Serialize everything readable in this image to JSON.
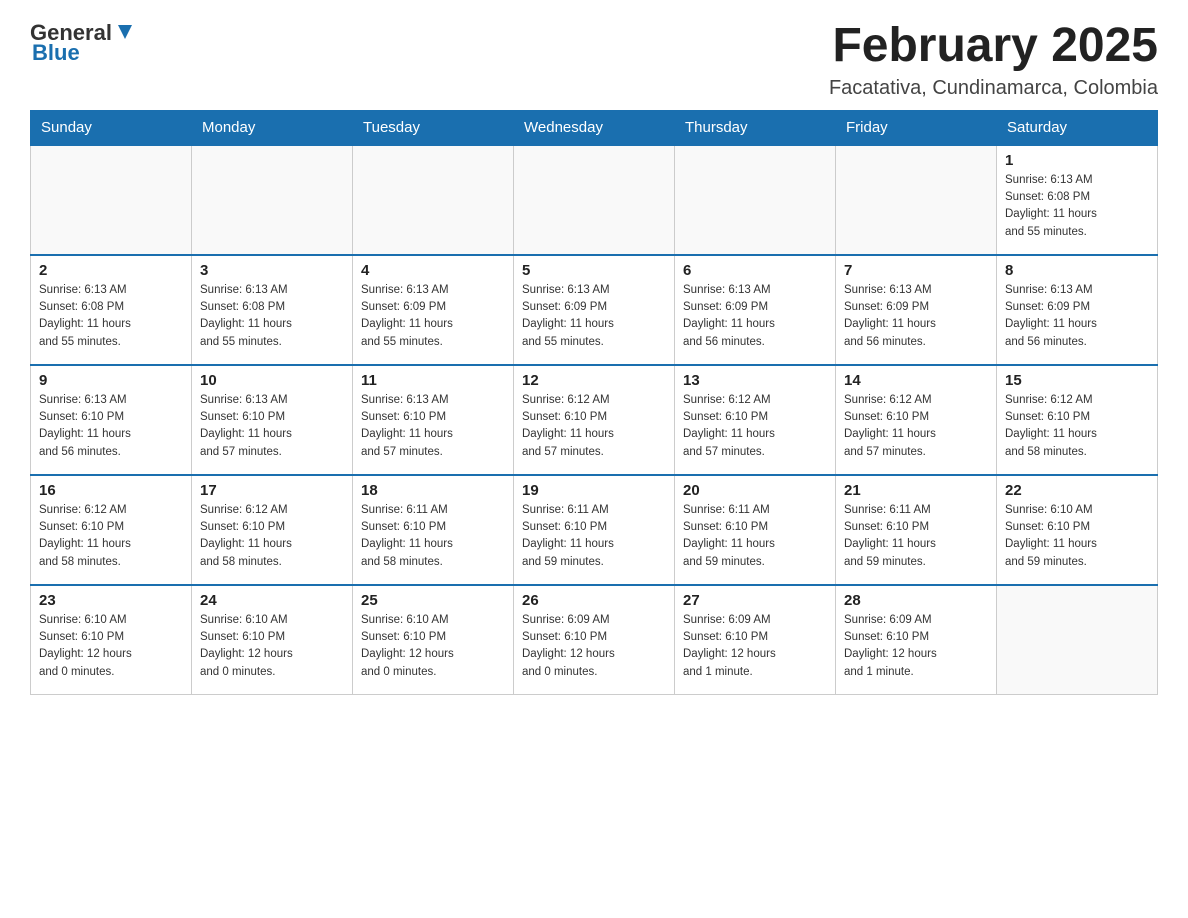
{
  "header": {
    "logo_general": "General",
    "logo_blue": "Blue",
    "month_title": "February 2025",
    "location": "Facatativa, Cundinamarca, Colombia"
  },
  "weekdays": [
    "Sunday",
    "Monday",
    "Tuesday",
    "Wednesday",
    "Thursday",
    "Friday",
    "Saturday"
  ],
  "weeks": [
    [
      {
        "day": "",
        "info": ""
      },
      {
        "day": "",
        "info": ""
      },
      {
        "day": "",
        "info": ""
      },
      {
        "day": "",
        "info": ""
      },
      {
        "day": "",
        "info": ""
      },
      {
        "day": "",
        "info": ""
      },
      {
        "day": "1",
        "info": "Sunrise: 6:13 AM\nSunset: 6:08 PM\nDaylight: 11 hours\nand 55 minutes."
      }
    ],
    [
      {
        "day": "2",
        "info": "Sunrise: 6:13 AM\nSunset: 6:08 PM\nDaylight: 11 hours\nand 55 minutes."
      },
      {
        "day": "3",
        "info": "Sunrise: 6:13 AM\nSunset: 6:08 PM\nDaylight: 11 hours\nand 55 minutes."
      },
      {
        "day": "4",
        "info": "Sunrise: 6:13 AM\nSunset: 6:09 PM\nDaylight: 11 hours\nand 55 minutes."
      },
      {
        "day": "5",
        "info": "Sunrise: 6:13 AM\nSunset: 6:09 PM\nDaylight: 11 hours\nand 55 minutes."
      },
      {
        "day": "6",
        "info": "Sunrise: 6:13 AM\nSunset: 6:09 PM\nDaylight: 11 hours\nand 56 minutes."
      },
      {
        "day": "7",
        "info": "Sunrise: 6:13 AM\nSunset: 6:09 PM\nDaylight: 11 hours\nand 56 minutes."
      },
      {
        "day": "8",
        "info": "Sunrise: 6:13 AM\nSunset: 6:09 PM\nDaylight: 11 hours\nand 56 minutes."
      }
    ],
    [
      {
        "day": "9",
        "info": "Sunrise: 6:13 AM\nSunset: 6:10 PM\nDaylight: 11 hours\nand 56 minutes."
      },
      {
        "day": "10",
        "info": "Sunrise: 6:13 AM\nSunset: 6:10 PM\nDaylight: 11 hours\nand 57 minutes."
      },
      {
        "day": "11",
        "info": "Sunrise: 6:13 AM\nSunset: 6:10 PM\nDaylight: 11 hours\nand 57 minutes."
      },
      {
        "day": "12",
        "info": "Sunrise: 6:12 AM\nSunset: 6:10 PM\nDaylight: 11 hours\nand 57 minutes."
      },
      {
        "day": "13",
        "info": "Sunrise: 6:12 AM\nSunset: 6:10 PM\nDaylight: 11 hours\nand 57 minutes."
      },
      {
        "day": "14",
        "info": "Sunrise: 6:12 AM\nSunset: 6:10 PM\nDaylight: 11 hours\nand 57 minutes."
      },
      {
        "day": "15",
        "info": "Sunrise: 6:12 AM\nSunset: 6:10 PM\nDaylight: 11 hours\nand 58 minutes."
      }
    ],
    [
      {
        "day": "16",
        "info": "Sunrise: 6:12 AM\nSunset: 6:10 PM\nDaylight: 11 hours\nand 58 minutes."
      },
      {
        "day": "17",
        "info": "Sunrise: 6:12 AM\nSunset: 6:10 PM\nDaylight: 11 hours\nand 58 minutes."
      },
      {
        "day": "18",
        "info": "Sunrise: 6:11 AM\nSunset: 6:10 PM\nDaylight: 11 hours\nand 58 minutes."
      },
      {
        "day": "19",
        "info": "Sunrise: 6:11 AM\nSunset: 6:10 PM\nDaylight: 11 hours\nand 59 minutes."
      },
      {
        "day": "20",
        "info": "Sunrise: 6:11 AM\nSunset: 6:10 PM\nDaylight: 11 hours\nand 59 minutes."
      },
      {
        "day": "21",
        "info": "Sunrise: 6:11 AM\nSunset: 6:10 PM\nDaylight: 11 hours\nand 59 minutes."
      },
      {
        "day": "22",
        "info": "Sunrise: 6:10 AM\nSunset: 6:10 PM\nDaylight: 11 hours\nand 59 minutes."
      }
    ],
    [
      {
        "day": "23",
        "info": "Sunrise: 6:10 AM\nSunset: 6:10 PM\nDaylight: 12 hours\nand 0 minutes."
      },
      {
        "day": "24",
        "info": "Sunrise: 6:10 AM\nSunset: 6:10 PM\nDaylight: 12 hours\nand 0 minutes."
      },
      {
        "day": "25",
        "info": "Sunrise: 6:10 AM\nSunset: 6:10 PM\nDaylight: 12 hours\nand 0 minutes."
      },
      {
        "day": "26",
        "info": "Sunrise: 6:09 AM\nSunset: 6:10 PM\nDaylight: 12 hours\nand 0 minutes."
      },
      {
        "day": "27",
        "info": "Sunrise: 6:09 AM\nSunset: 6:10 PM\nDaylight: 12 hours\nand 1 minute."
      },
      {
        "day": "28",
        "info": "Sunrise: 6:09 AM\nSunset: 6:10 PM\nDaylight: 12 hours\nand 1 minute."
      },
      {
        "day": "",
        "info": ""
      }
    ]
  ]
}
